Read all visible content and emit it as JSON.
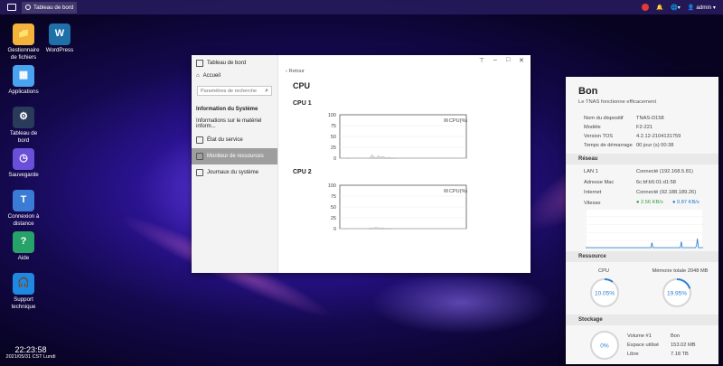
{
  "taskbar": {
    "app_tab": "Tableau de bord",
    "user": "admin"
  },
  "desktop": {
    "icons": [
      {
        "label": "Gestionnaire de fichiers",
        "color": "#f4b33a",
        "glyph": "📁"
      },
      {
        "label": "WordPress",
        "color": "#1f6fa8",
        "glyph": "W"
      },
      {
        "label": "Applications",
        "color": "#4aa3f0",
        "glyph": "▦"
      },
      {
        "label": "Tableau de bord",
        "color": "#2a3a5a",
        "glyph": "⚙"
      },
      {
        "label": "Sauvegarde",
        "color": "#6a4fd8",
        "glyph": "◷"
      },
      {
        "label": "Connexion à distance",
        "color": "#3a7bd5",
        "glyph": "T"
      },
      {
        "label": "Aide",
        "color": "#27a36a",
        "glyph": "?"
      },
      {
        "label": "Support technique",
        "color": "#1e88e5",
        "glyph": "🎧"
      }
    ]
  },
  "clock": {
    "time": "22:23:58",
    "date": "2021/05/31 CST Lundi"
  },
  "window": {
    "sidebar": {
      "title": "Tableau de bord",
      "home": "Accueil",
      "search_placeholder": "Paramètres de recherche",
      "section": "Information du Système",
      "items": [
        "Informations sur le matériel inform...",
        "État du service",
        "Moniteur de ressources",
        "Journaux du système"
      ],
      "active_index": 2
    },
    "back": "Retour",
    "title": "CPU"
  },
  "chart_data": [
    {
      "type": "area",
      "title": "CPU 1",
      "legend": "CPU(%)",
      "yticks": [
        "100",
        "75",
        "50",
        "25",
        "0"
      ],
      "ylim": [
        0,
        100
      ],
      "values": [
        0,
        0,
        0,
        1,
        1,
        0,
        0,
        0,
        0,
        0,
        0,
        0,
        0,
        0,
        1,
        8,
        3,
        1,
        6,
        2,
        4,
        2,
        1,
        2,
        1,
        1,
        1,
        0,
        0,
        0,
        0,
        0,
        0,
        0,
        0,
        0,
        0,
        0,
        0,
        0,
        0,
        0,
        0,
        0,
        0,
        0,
        0,
        0,
        0,
        0,
        0,
        0,
        0,
        0,
        0,
        0,
        0,
        0,
        0,
        0
      ]
    },
    {
      "type": "area",
      "title": "CPU 2",
      "legend": "CPU(%)",
      "yticks": [
        "100",
        "75",
        "50",
        "25",
        "0"
      ],
      "ylim": [
        0,
        100
      ],
      "values": [
        0,
        0,
        0,
        1,
        0,
        0,
        0,
        0,
        0,
        0,
        0,
        0,
        0,
        0,
        2,
        1,
        2,
        3,
        2,
        1,
        2,
        1,
        1,
        1,
        1,
        0,
        0,
        0,
        0,
        0,
        0,
        0,
        0,
        0,
        0,
        0,
        0,
        0,
        0,
        0,
        0,
        0,
        0,
        0,
        0,
        0,
        0,
        0,
        0,
        0,
        0,
        0,
        0,
        0,
        0,
        0,
        0,
        0,
        0,
        0
      ]
    }
  ],
  "panel": {
    "status": "Bon",
    "subtitle": "Le TNAS fonctionne efficacement",
    "device": [
      [
        "Nom du dispositif",
        "TNAS-D158"
      ],
      [
        "Modèle",
        "F2-221"
      ],
      [
        "Version TOS",
        "4.2.12-2104131759"
      ],
      [
        "Temps de démarrage",
        "00 jour (s) 00:38"
      ]
    ],
    "network_title": "Réseau",
    "network": [
      [
        "LAN 1",
        "Connecté (192.168.5.81)"
      ],
      [
        "Adresse Mac",
        "6c:bf:b5:01:d1:58"
      ],
      [
        "Internet",
        "Connecté (92.188.189.26)"
      ],
      [
        "Vitesse",
        ""
      ]
    ],
    "speed_up": "2.56 KB/s",
    "speed_down": "0.87 KB/s",
    "net_chart": {
      "values": [
        0,
        0,
        0,
        0,
        0,
        0,
        0,
        0,
        0,
        0,
        0,
        0,
        0,
        0,
        0,
        0,
        0,
        0,
        0,
        0,
        0,
        0,
        0,
        0,
        0,
        0,
        0,
        0,
        0,
        0,
        0,
        0,
        0,
        0,
        0,
        0,
        0,
        0,
        0,
        0,
        0,
        0,
        0,
        0,
        0,
        0,
        0,
        0,
        0,
        0,
        0,
        0,
        0,
        0,
        0,
        0,
        0,
        0,
        0,
        0,
        0,
        0,
        0,
        0,
        0,
        0,
        0,
        0,
        0,
        0,
        5,
        0,
        0,
        0,
        0,
        0,
        0,
        0,
        0,
        0,
        0,
        0,
        0,
        0,
        0,
        0,
        0,
        0,
        0,
        0,
        0,
        0,
        0,
        0,
        0,
        0,
        0,
        0,
        0,
        0,
        0,
        6,
        0,
        0,
        0,
        0,
        0,
        0,
        0,
        0,
        0,
        0,
        0,
        0,
        0,
        0,
        0,
        2,
        9,
        0,
        0,
        0,
        0,
        0,
        0
      ]
    },
    "resource_title": "Ressource",
    "cpu_label": "CPU",
    "cpu_value": "10.05%",
    "cpu_pct": 10.05,
    "mem_label": "Mémoire totale 2048 MB",
    "mem_value": "19.95%",
    "mem_pct": 19.95,
    "storage_title": "Stockage",
    "storage_value": "0%",
    "storage_pct": 0,
    "storage": [
      [
        "Volume #1",
        "Bon"
      ],
      [
        "Espace utilisé",
        "153.02 MB"
      ],
      [
        "Libre",
        "7.18 TB"
      ]
    ]
  }
}
